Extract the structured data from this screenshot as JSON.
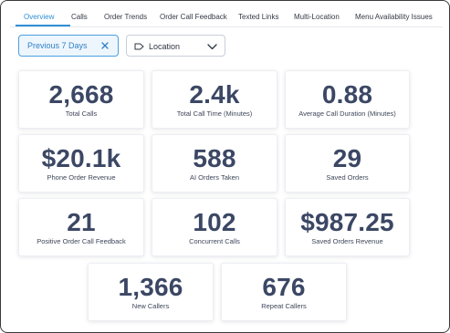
{
  "tabs": [
    {
      "label": "Overview",
      "active": true
    },
    {
      "label": "Calls"
    },
    {
      "label": "Order Trends"
    },
    {
      "label": "Order Call Feedback"
    },
    {
      "label": "Texted Links"
    },
    {
      "label": "Multi-Location"
    },
    {
      "label": "Menu Availability Issues"
    }
  ],
  "filters": {
    "date_range": "Previous 7 Days",
    "date_clear_icon": "close-icon",
    "location_label": "Location",
    "location_icon": "tag-icon",
    "location_dropdown_icon": "chevron-down-icon"
  },
  "metrics": [
    {
      "value": "2,668",
      "label": "Total Calls"
    },
    {
      "value": "2.4k",
      "label": "Total Call Time (Minutes)"
    },
    {
      "value": "0.88",
      "label": "Average Call Duration (Minutes)"
    },
    {
      "value": "$20.1k",
      "label": "Phone Order Revenue"
    },
    {
      "value": "588",
      "label": "AI Orders Taken"
    },
    {
      "value": "29",
      "label": "Saved Orders"
    },
    {
      "value": "21",
      "label": "Positive Order Call Feedback"
    },
    {
      "value": "102",
      "label": "Concurrent Calls"
    },
    {
      "value": "$987.25",
      "label": "Saved Orders Revenue"
    },
    {
      "value": "1,366",
      "label": "New Callers"
    },
    {
      "value": "676",
      "label": "Repeat Callers"
    }
  ],
  "colors": {
    "accent": "#2f8fd6",
    "metric_value": "#3b4764",
    "card_border": "#eceef2"
  }
}
